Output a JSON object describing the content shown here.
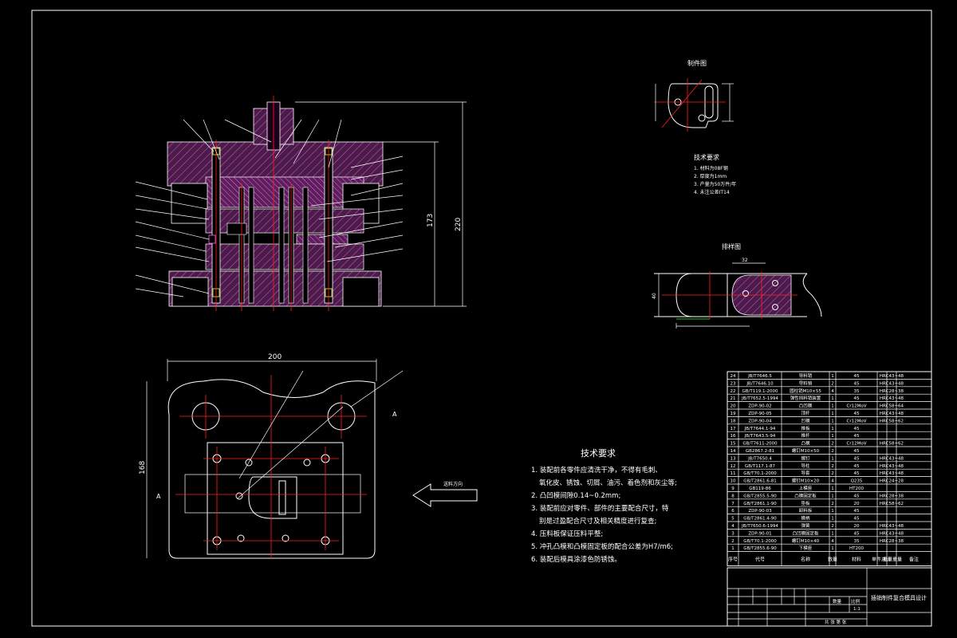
{
  "drawing": {
    "workpiece_title": "制件图",
    "layout_title": "排样图",
    "small_tech_title": "技术要求",
    "small_tech_items": [
      "1. 材料为08F钢",
      "2. 厚度为1mm",
      "3. 产量为50万件/年",
      "4. 未注公差IT14"
    ],
    "tech_title": "技术要求",
    "tech_items": [
      "1. 装配前各零件应清洗干净，不得有毛刺、",
      "氧化皮、锈蚀、切屑、油污、着色剂和灰尘等;",
      "2. 凸凹模间隙0.14~0.2mm;",
      "3. 装配前应对零件、部件的主要配合尺寸，特",
      "别是过盈配合尺寸及相关精度进行复查;",
      "4. 压料板保证压料平整;",
      "5. 冲孔凸模和凸模固定板的配合公差为H7/m6;",
      "6. 装配后模具涂漆色防锈蚀。"
    ],
    "feed_label": "送料方向",
    "dim_overall_height": "220",
    "dim_closed_height": "173",
    "dim_plan_width": "200",
    "dim_plan_depth": "168",
    "dim_step": "32",
    "dim_layout_width": "40"
  },
  "bom": {
    "rows": [
      [
        "24",
        "JB/T7646.5",
        "导料销",
        "1",
        "45",
        "",
        "HRC43~48"
      ],
      [
        "23",
        "JB/T7646.10",
        "导料销",
        "2",
        "45",
        "",
        "HRC43~48"
      ],
      [
        "22",
        "GB/T119.1-2000",
        "圆柱销M10×55",
        "4",
        "35",
        "",
        "HRC28~38"
      ],
      [
        "21",
        "JB/T7652.5-1994",
        "弹性挡料销装置",
        "1",
        "45",
        "",
        "HRC43~48"
      ],
      [
        "20",
        "ZDP-90-02",
        "凸凹模",
        "1",
        "Cr12MoV",
        "",
        "HRC58~64"
      ],
      [
        "19",
        "ZDP-90-05",
        "顶杆",
        "1",
        "45",
        "",
        "HRC43~48"
      ],
      [
        "18",
        "ZDP-90-04",
        "凹模",
        "1",
        "Cr12MoV",
        "",
        "HRC58~62"
      ],
      [
        "17",
        "JB/T7644.1-94",
        "推板",
        "1",
        "45",
        "",
        ""
      ],
      [
        "16",
        "JB/T7643.5-94",
        "推杆",
        "1",
        "45",
        "",
        ""
      ],
      [
        "15",
        "GB/T7611-2000",
        "凸模",
        "2",
        "Cr12MoV",
        "",
        "HRC58~62"
      ],
      [
        "14",
        "GB2867.2-81",
        "螺钉M10×50",
        "2",
        "45",
        "",
        ""
      ],
      [
        "13",
        "JB/T7650.4",
        "螺钉",
        "1",
        "45",
        "",
        "HRC43~48"
      ],
      [
        "12",
        "GB/T117.1-87",
        "导柱",
        "2",
        "45",
        "",
        "HRC43~48"
      ],
      [
        "11",
        "GB/T70.1-2000",
        "导套",
        "2",
        "45",
        "",
        "HRC43~48"
      ],
      [
        "10",
        "GB/T2861.6-81",
        "螺钉M10×20",
        "4",
        "Q235",
        "",
        "HRC24~28"
      ],
      [
        "9",
        "GB119-86",
        "上模座",
        "1",
        "HT200",
        "",
        ""
      ],
      [
        "8",
        "GB/T2855.5-90",
        "凸模固定板",
        "1",
        "45",
        "",
        "HRC28~38"
      ],
      [
        "7",
        "GB/T2861.1-90",
        "垫板",
        "2",
        "20",
        "",
        "HRC58~62"
      ],
      [
        "6",
        "ZDP-90-03",
        "卸料板",
        "1",
        "45",
        "",
        ""
      ],
      [
        "5",
        "GB/T2861.4-90",
        "模柄",
        "1",
        "45",
        "",
        ""
      ],
      [
        "4",
        "JB/T7650.6-1994",
        "弹簧",
        "2",
        "20",
        "",
        "HRC43~48"
      ],
      [
        "3",
        "ZDP-90-01",
        "凸凹模固定板",
        "1",
        "45",
        "",
        "HRC43~48"
      ],
      [
        "2",
        "GB/T70.1-2000",
        "螺钉M10×40",
        "4",
        "35",
        "",
        "HRC28~38"
      ],
      [
        "1",
        "GB/T2855.6-90",
        "下模座",
        "1",
        "HT200",
        "",
        ""
      ]
    ],
    "header": [
      "序号",
      "代号",
      "名称",
      "数量",
      "材料",
      "单件 重量",
      "总计 重量",
      "备注"
    ],
    "design_title": "插销制件复合模具设计",
    "scale_label": "比例",
    "scale_value": "1:1",
    "qty_label": "数量",
    "sheet_label": "共 张 第 张"
  }
}
